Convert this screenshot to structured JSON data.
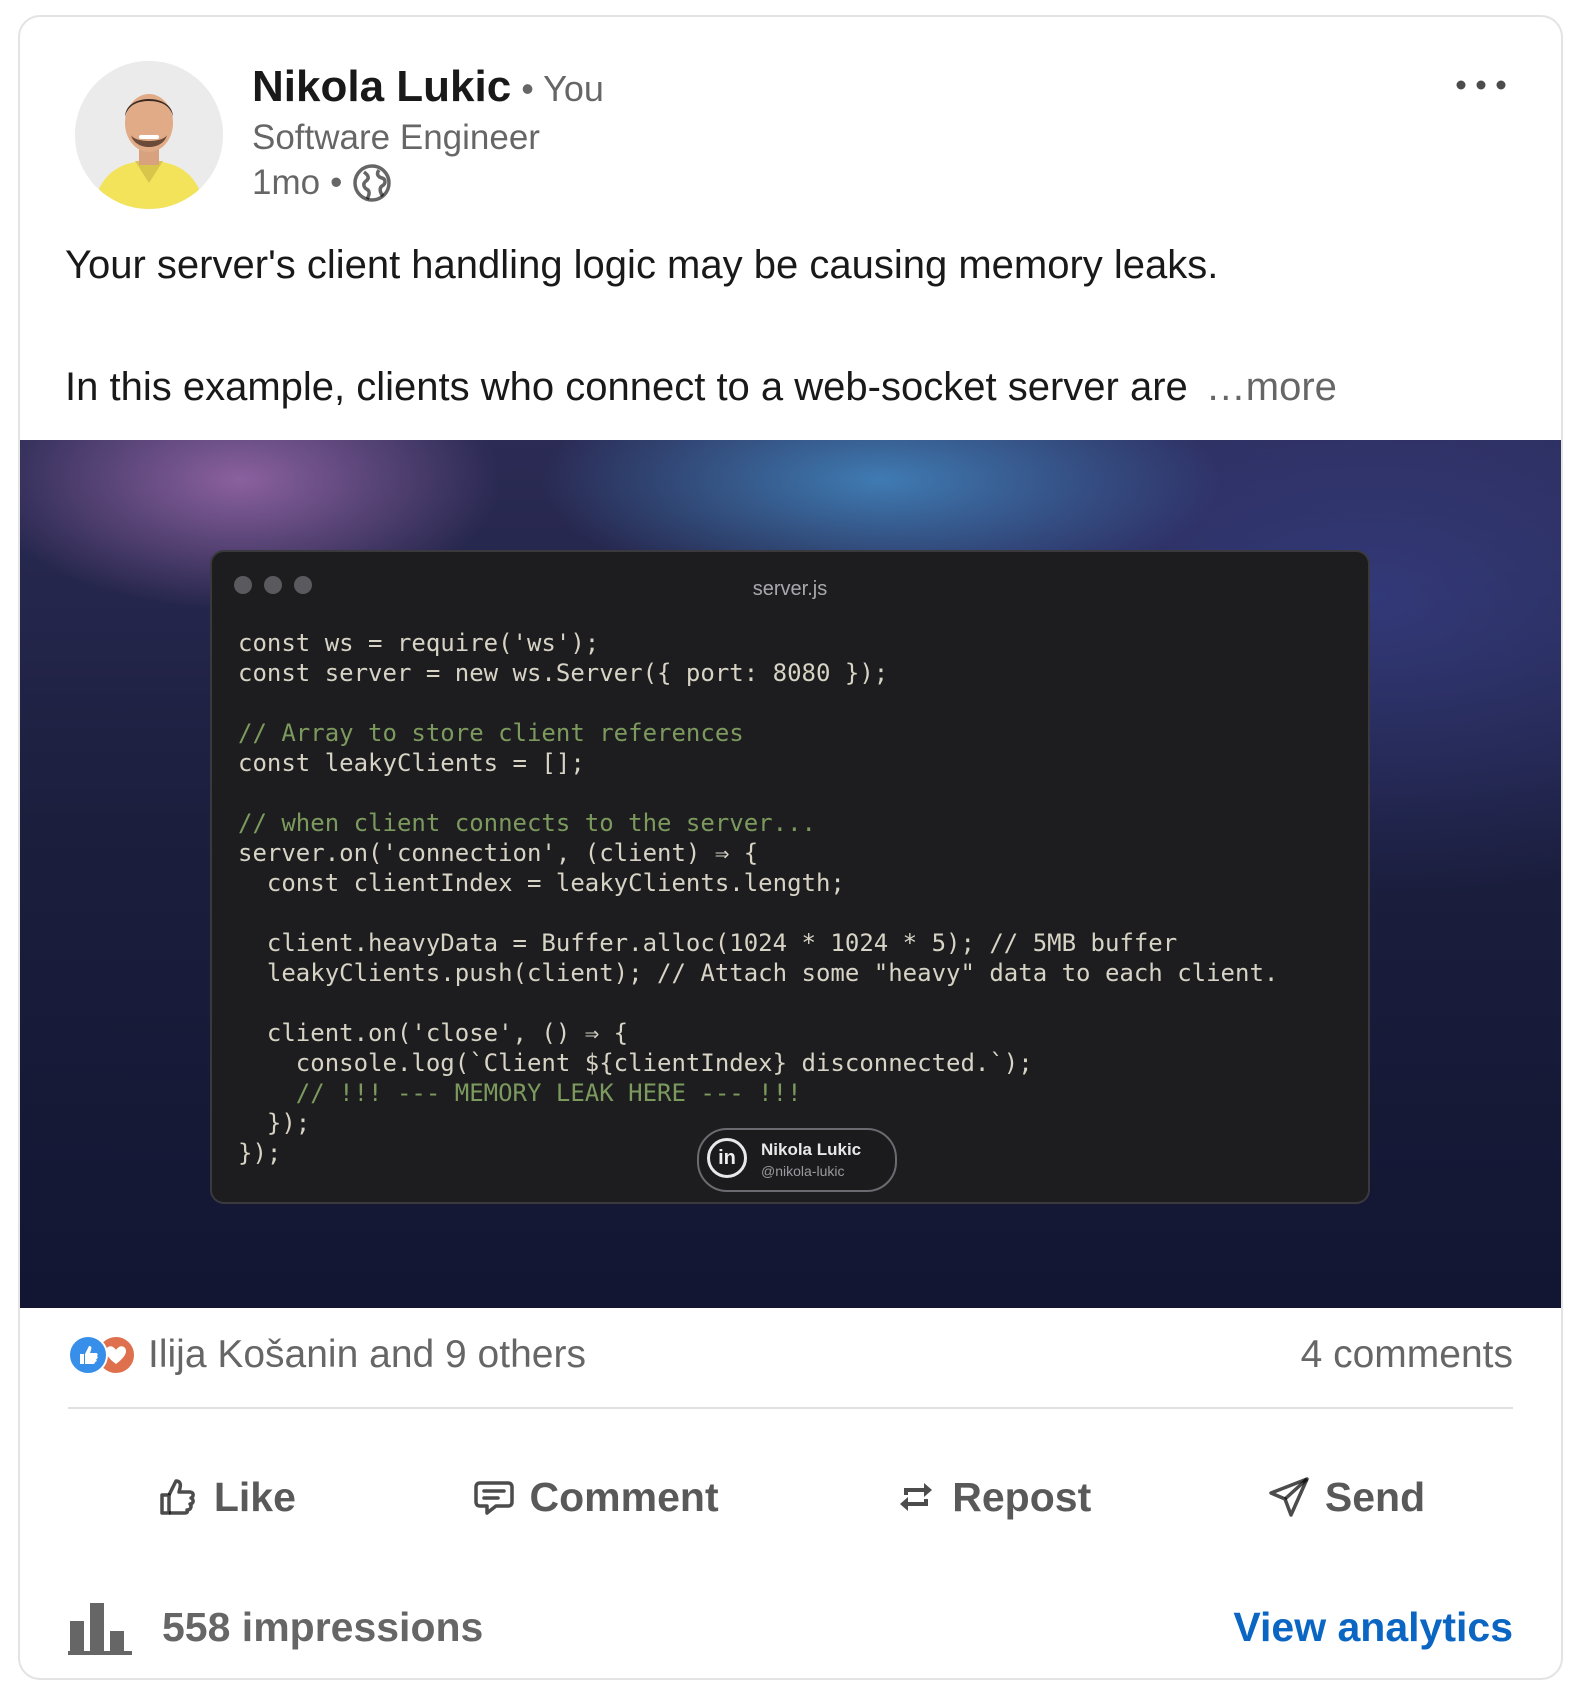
{
  "post": {
    "author": {
      "name": "Nikola Lukic",
      "relation": "• You",
      "headline": "Software Engineer",
      "time": "1mo",
      "time_separator": "•",
      "visibility_icon": "globe-icon"
    },
    "menu_icon": "more-horizontal-icon",
    "text_line_1": "Your server's client handling logic may be causing memory leaks.",
    "text_line_2": "In this example, clients who connect to a web-socket server are",
    "see_more": "…more"
  },
  "media": {
    "file_name": "server.js",
    "code_lines": [
      "const ws = require('ws');",
      "const server = new ws.Server({ port: 8080 });",
      "",
      "// Array to store client references",
      "const leakyClients = [];",
      "",
      "// when client connects to the server...",
      "server.on('connection', (client) ⇒ {",
      "  const clientIndex = leakyClients.length;",
      "",
      "  client.heavyData = Buffer.alloc(1024 * 1024 * 5); // 5MB buffer",
      "  leakyClients.push(client); // Attach some \"heavy\" data to each client.",
      "",
      "  client.on('close', () ⇒ {",
      "    console.log(`Client ${clientIndex} disconnected.`);",
      "    // !!! --- MEMORY LEAK HERE --- !!!",
      "  });",
      "});"
    ],
    "watermark_name": "Nikola Lukic",
    "watermark_handle": "@nikola-lukic",
    "watermark_logo": "in"
  },
  "social": {
    "reaction_icons": [
      "like-reaction-icon",
      "love-reaction-icon"
    ],
    "likers": "Ilija Košanin and 9 others",
    "comments": "4 comments"
  },
  "actions": {
    "like": "Like",
    "comment": "Comment",
    "repost": "Repost",
    "send": "Send"
  },
  "footer": {
    "impressions": "558 impressions",
    "view_analytics": "View analytics"
  },
  "colors": {
    "link": "#0a66c2",
    "like_reaction": "#378fe9",
    "love_reaction": "#df704d"
  }
}
